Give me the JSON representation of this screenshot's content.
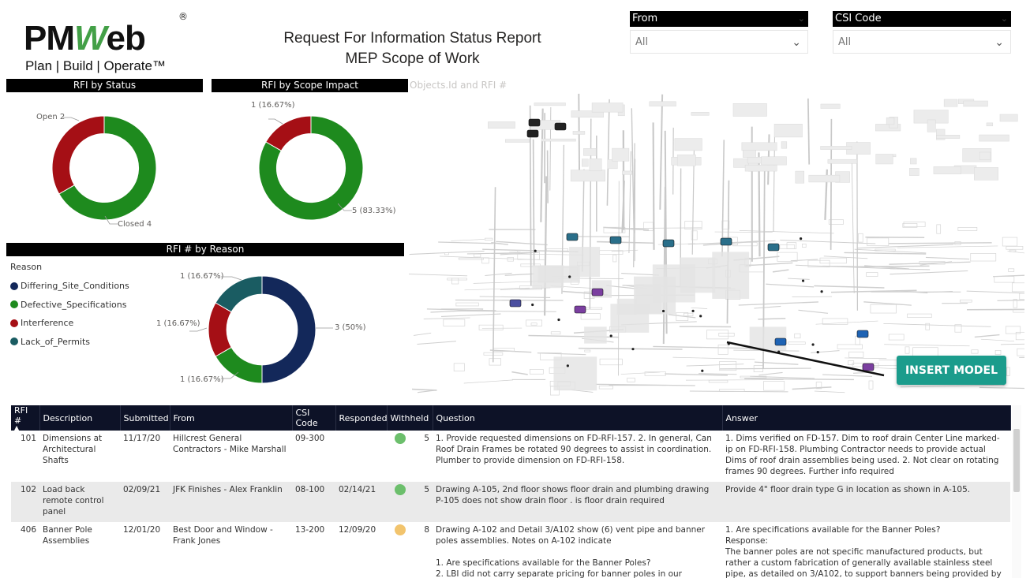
{
  "logo": {
    "brand_pm": "PM",
    "brand_w": "W",
    "brand_eb": "eb",
    "registered": "®",
    "tagline": "Plan | Build | Operate™"
  },
  "report": {
    "title_line1": "Request For Information Status Report",
    "title_line2": "MEP Scope of Work"
  },
  "slicers": {
    "from": {
      "label": "From",
      "value": "All"
    },
    "csi": {
      "label": "CSI Code",
      "value": "All"
    }
  },
  "panels": {
    "status_title": "RFI by Status",
    "scope_title": "RFI by Scope Impact",
    "reason_title": "RFI # by Reason",
    "model_title": "Objects.Id and RFI #"
  },
  "chart_data": [
    {
      "type": "pie",
      "title": "RFI by Status",
      "labels": [
        "Open",
        "Closed"
      ],
      "values": [
        2,
        4
      ],
      "colors": [
        "#a50f15",
        "#1e8a1e"
      ],
      "data_labels": [
        "Open 2",
        "Closed 4"
      ]
    },
    {
      "type": "pie",
      "title": "RFI by Scope Impact",
      "labels": [
        "",
        ""
      ],
      "values": [
        1,
        5
      ],
      "colors": [
        "#a50f15",
        "#1e8a1e"
      ],
      "data_labels": [
        "1 (16.67%)",
        "5 (83.33%)"
      ]
    },
    {
      "type": "pie",
      "title": "RFI # by Reason",
      "legend_title": "Reason",
      "labels": [
        "Differing_Site_Conditions",
        "Defective_Specifications",
        "Interference",
        "Lack_of_Permits"
      ],
      "values": [
        3,
        1,
        1,
        1
      ],
      "colors": [
        "#13285a",
        "#1e8a1e",
        "#a50f15",
        "#1a5c62"
      ],
      "data_labels": [
        "3 (50%)",
        "1 (16.67%)",
        "1 (16.67%)",
        "1 (16.67%)"
      ]
    }
  ],
  "model": {
    "insert_label": "INSERT MODEL"
  },
  "table": {
    "headers": [
      "RFI #",
      "Description",
      "Submitted",
      "From",
      "CSI Code",
      "Responded",
      "Withheld",
      "Question",
      "Answer"
    ],
    "rows": [
      {
        "rfi": "101",
        "description": "Dimensions at Architectural Shafts",
        "submitted": "11/17/20",
        "from": "Hillcrest General Contractors - Mike Marshall",
        "csi": "09-300",
        "responded": "",
        "withheld_color": "#6cbf6c",
        "withheld": "5",
        "question": "1. Provide requested dimensions on FD-RFI-157. 2. In general, Can Roof Drain Frames be rotated 90 degrees to assist in coordination. Plumber to provide dimension on FD-RFI-158.",
        "answer": "1. Dims verified on FD-157. Dim to roof drain Center Line marked-ip on FD-RFI-158. Plumbing Contractor needs to provide actual Dims of roof drain assemblies being used. 2. Not clear on rotating frames 90 degrees. Further info required"
      },
      {
        "rfi": "102",
        "description": "Load back remote control panel",
        "submitted": "02/09/21",
        "from": "JFK Finishes - Alex Franklin",
        "csi": "08-100",
        "responded": "02/14/21",
        "withheld_color": "#6cbf6c",
        "withheld": "5",
        "question": "Drawing A-105, 2nd floor shows floor drain and plumbing drawing P-105 does not show drain floor . is floor drain required",
        "answer": "Provide 4\" floor drain type G in location as shown in A-105."
      },
      {
        "rfi": "406",
        "description": "Banner Pole Assemblies",
        "submitted": "12/01/20",
        "from": "Best Door and Window - Frank Jones",
        "csi": "13-200",
        "responded": "12/09/20",
        "withheld_color": "#f2c46d",
        "withheld": "8",
        "question": "Drawing A-102 and Detail 3/A102 show (6) vent pipe and banner poles assemblies. Notes on A-102 indicate\n\n1. Are specifications available for the Banner Poles?\n2. LBI did not carry separate pricing for banner poles in our estimate",
        "answer": "1. Are specifications available for the Banner Poles?\nResponse:\nThe banner poles are not specific manufactured products, but rather a custom fabrication of generally available stainless steel pipe, as detailed on 3/A102, to support banners being provided by the Owner."
      }
    ]
  }
}
